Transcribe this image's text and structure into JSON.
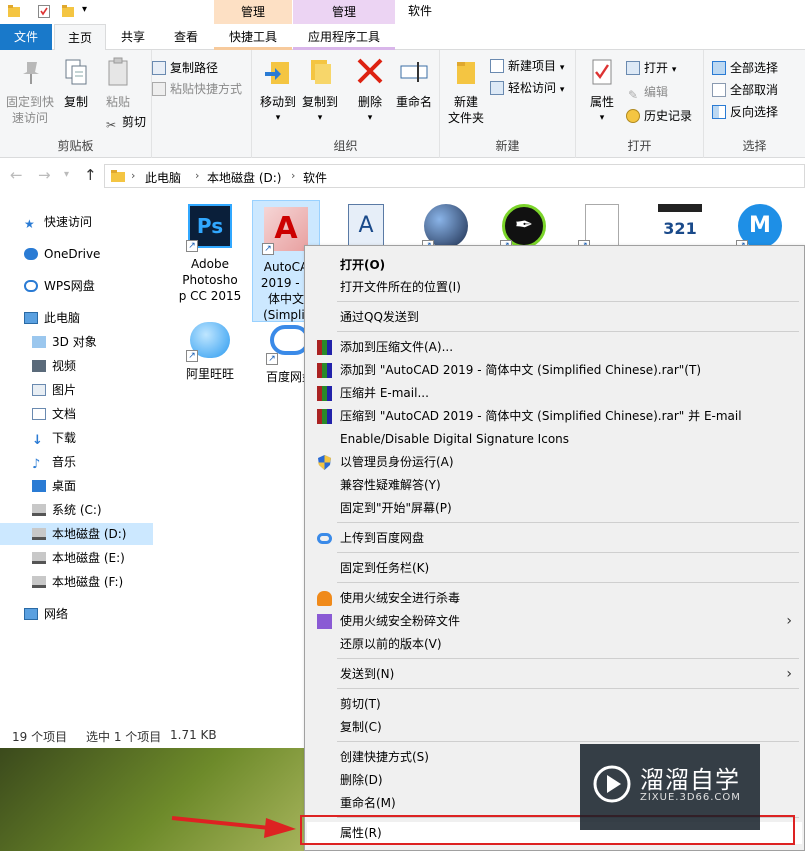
{
  "window": {
    "title": "软件",
    "context_tabs": [
      "管理",
      "管理"
    ]
  },
  "ribbon_tabs": [
    "文件",
    "主页",
    "共享",
    "查看",
    "快捷工具",
    "应用程序工具"
  ],
  "ribbon": {
    "clipboard": {
      "pin_label_1": "固定到快",
      "pin_label_2": "速访问",
      "copy": "复制",
      "paste": "粘贴",
      "copy_path": "复制路径",
      "paste_shortcut": "粘贴快捷方式",
      "cut": "剪切",
      "label": "剪贴板"
    },
    "organize": {
      "move_to": "移动到",
      "copy_to": "复制到",
      "delete": "删除",
      "rename": "重命名",
      "label": "组织"
    },
    "new": {
      "new_folder_1": "新建",
      "new_folder_2": "文件夹",
      "new_item": "新建项目",
      "easy_access": "轻松访问",
      "label": "新建"
    },
    "open": {
      "properties": "属性",
      "open": "打开",
      "edit": "编辑",
      "history": "历史记录",
      "label": "打开"
    },
    "select": {
      "select_all": "全部选择",
      "select_none": "全部取消",
      "invert": "反向选择",
      "label": "选择"
    }
  },
  "address": {
    "crumbs": [
      "此电脑",
      "本地磁盘 (D:)",
      "软件"
    ]
  },
  "nav_pane": {
    "items": [
      "快速访问",
      "OneDrive",
      "WPS网盘",
      "此电脑",
      "3D 对象",
      "视频",
      "图片",
      "文档",
      "下载",
      "音乐",
      "桌面",
      "系统 (C:)",
      "本地磁盘 (D:)",
      "本地磁盘 (E:)",
      "本地磁盘 (F:)",
      "网络"
    ]
  },
  "files": [
    {
      "line1": "Adobe",
      "line2": "Photosho",
      "line3": "p CC 2015",
      "icon": "photoshop-icon"
    },
    {
      "line1": "AutoCA",
      "line2": "2019 - 1",
      "line3": "体中文",
      "line4": "(Simplif",
      "icon": "autocad-icon"
    },
    {
      "line1": "",
      "icon": "wordpad-icon"
    },
    {
      "line1": "",
      "icon": "cinema4d-icon"
    },
    {
      "line1": "",
      "icon": "sketch-pen-icon"
    },
    {
      "line1": "",
      "icon": "document-icon"
    },
    {
      "line1": "",
      "icon": "media-player-icon"
    },
    {
      "line1": "",
      "icon": "app-m-icon"
    },
    {
      "line1": "阿里旺旺",
      "icon": "aliwangwang-icon"
    },
    {
      "line1": "百度网盘",
      "icon": "baidu-netdisk-icon"
    }
  ],
  "status": {
    "count": "19 个项目",
    "selected": "选中 1 个项目",
    "size": "1.71 KB"
  },
  "context_menu": {
    "items": [
      "打开(O)",
      "打开文件所在的位置(I)",
      "通过QQ发送到",
      "添加到压缩文件(A)...",
      "添加到 \"AutoCAD 2019 - 简体中文 (Simplified Chinese).rar\"(T)",
      "压缩并 E-mail...",
      "压缩到 \"AutoCAD 2019 - 简体中文 (Simplified Chinese).rar\" 并 E-mail",
      "Enable/Disable Digital Signature Icons",
      "以管理员身份运行(A)",
      "兼容性疑难解答(Y)",
      "固定到\"开始\"屏幕(P)",
      "上传到百度网盘",
      "固定到任务栏(K)",
      "使用火绒安全进行杀毒",
      "使用火绒安全粉碎文件",
      "还原以前的版本(V)",
      "发送到(N)",
      "剪切(T)",
      "复制(C)",
      "创建快捷方式(S)",
      "删除(D)",
      "重命名(M)",
      "属性(R)"
    ]
  },
  "watermark": {
    "title": "溜溜自学",
    "subtitle": "ZIXUE.3D66.COM"
  }
}
